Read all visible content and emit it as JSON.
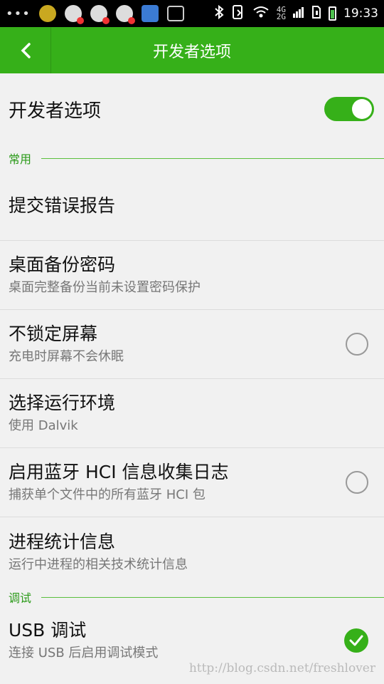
{
  "status_bar": {
    "dots": "•••",
    "network_label_top": "4G",
    "network_label_bottom": "2G",
    "time": "19:33"
  },
  "app_bar": {
    "title": "开发者选项"
  },
  "master_switch": {
    "label": "开发者选项",
    "on": true
  },
  "sections": {
    "common": "常用",
    "debug": "调试"
  },
  "prefs": [
    {
      "title": "提交错误报告",
      "summary": ""
    },
    {
      "title": "桌面备份密码",
      "summary": "桌面完整备份当前未设置密码保护"
    },
    {
      "title": "不锁定屏幕",
      "summary": "充电时屏幕不会休眠",
      "checked": false
    },
    {
      "title": "选择运行环境",
      "summary": "使用 Dalvik"
    },
    {
      "title": "启用蓝牙 HCI 信息收集日志",
      "summary": "捕获单个文件中的所有蓝牙 HCI 包",
      "checked": false
    },
    {
      "title": "进程统计信息",
      "summary": "运行中进程的相关技术统计信息"
    },
    {
      "title": "USB 调试",
      "summary": "连接 USB 后启用调试模式",
      "checked": true
    }
  ],
  "watermark": "http://blog.csdn.net/freshlover",
  "colors": {
    "accent": "#36b019",
    "section_text": "#2a9a18"
  }
}
